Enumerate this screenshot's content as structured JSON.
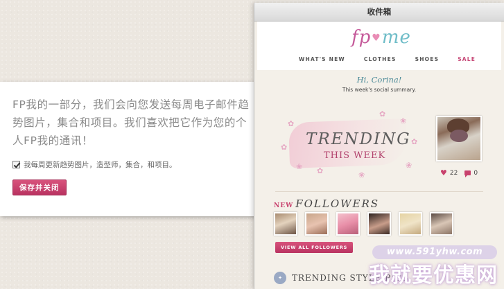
{
  "subscription": {
    "text": "FP我的一部分，我们会向您发送每周电子邮件趋势图片，集合和项目。我们喜欢把它作为您的个人FP我的通讯！",
    "checkbox_label": "我每周更新趋势图片，造型师，集合，和项目。",
    "checkbox_checked": true,
    "save_button": "保存并关闭"
  },
  "inbox": {
    "title": "收件箱",
    "logo": {
      "fp": "fp",
      "me": "me"
    },
    "nav": [
      "WHAT'S NEW",
      "CLOTHES",
      "SHOES",
      "SALE"
    ],
    "greeting": "Hi, Corina!",
    "summary": "This week's social summary.",
    "trending": {
      "title": "TRENDING",
      "subtitle": "THIS WEEK",
      "likes": "22",
      "comments": "0"
    },
    "followers": {
      "new": "NEW",
      "title": "FOLLOWERS",
      "button": "VIEW ALL FOLLOWERS"
    },
    "trending_style": "TRENDING STYLE PICS"
  },
  "watermark": {
    "url": "www.591yhw.com",
    "name": "我就要优惠网"
  },
  "colors": {
    "accent": "#c8416d",
    "teal": "#4c8a98"
  },
  "icons": [
    "checkbox-icon",
    "heart-icon",
    "comment-icon",
    "tag-icon"
  ]
}
